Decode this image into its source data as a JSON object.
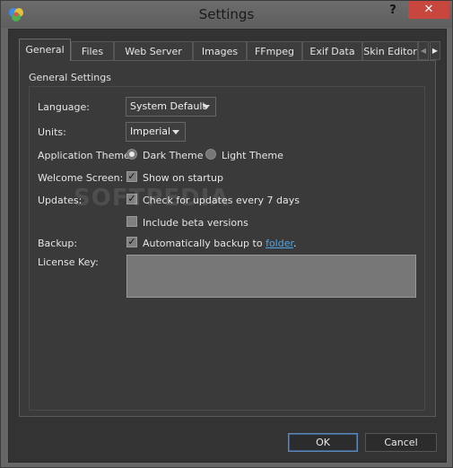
{
  "window": {
    "title": "Settings",
    "help_label": "?",
    "close_label": "✕"
  },
  "tabs": [
    {
      "label": "General",
      "active": true
    },
    {
      "label": "Files"
    },
    {
      "label": "Web Server"
    },
    {
      "label": "Images"
    },
    {
      "label": "FFmpeg"
    },
    {
      "label": "Exif Data"
    },
    {
      "label": "Skin Editor"
    }
  ],
  "tab_scroll": {
    "left": "◀",
    "right": "▶"
  },
  "general": {
    "group_title": "General Settings",
    "language": {
      "label": "Language:",
      "value": "System Default"
    },
    "units": {
      "label": "Units:",
      "value": "Imperial"
    },
    "theme": {
      "label": "Application Theme:",
      "options": [
        {
          "label": "Dark Theme",
          "checked": true
        },
        {
          "label": "Light Theme",
          "checked": false
        }
      ]
    },
    "welcome": {
      "label": "Welcome Screen:",
      "option": "Show on startup",
      "checked": true
    },
    "updates": {
      "label": "Updates:",
      "check_label": "Check for updates every 7 days",
      "check_checked": true,
      "beta_label": "Include beta versions",
      "beta_checked": false
    },
    "backup": {
      "label": "Backup:",
      "option_prefix": "Automatically backup to ",
      "option_link": "folder",
      "option_suffix": ".",
      "checked": true
    },
    "license": {
      "label": "License Key:",
      "value": ""
    }
  },
  "buttons": {
    "ok": "OK",
    "cancel": "Cancel"
  },
  "watermark": "SOFTPEDIA",
  "colors": {
    "close": "#c7463d",
    "link": "#4ea6ea",
    "dark_bg": "#333333"
  }
}
